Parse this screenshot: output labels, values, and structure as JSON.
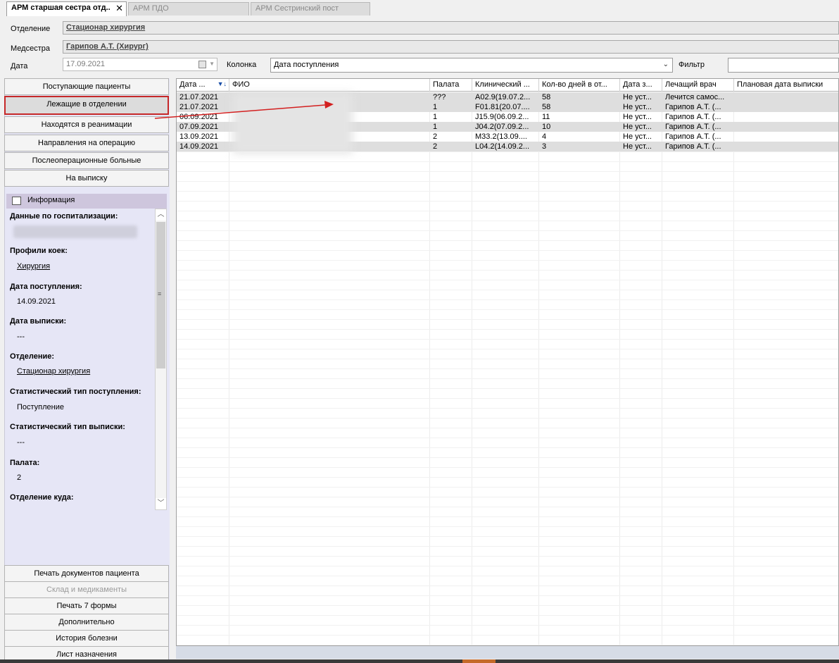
{
  "tabs": [
    {
      "label": "АРМ старшая сестра отд..",
      "active": true
    },
    {
      "label": "АРМ ПДО",
      "active": false
    },
    {
      "label": "АРМ Сестринский пост",
      "active": false
    }
  ],
  "header": {
    "department_label": "Отделение",
    "department_value": "Стационар хирургия",
    "nurse_label": "Медсестра",
    "nurse_value": "Гарипов А.Т. (Хирург)",
    "date_label": "Дата",
    "date_value": "17.09.2021",
    "column_label": "Колонка",
    "column_value": "Дата поступления",
    "filter_label": "Фильтр",
    "filter_value": ""
  },
  "nav": {
    "items": [
      {
        "label": "Поступающие пациенты",
        "selected": false
      },
      {
        "label": "Лежащие в отделении",
        "selected": true
      },
      {
        "label": "Находятся в реанимации",
        "selected": false
      },
      {
        "label": "Направления на операцию",
        "selected": false
      },
      {
        "label": "Послеоперационные больные",
        "selected": false
      },
      {
        "label": "На выписку",
        "selected": false
      }
    ],
    "bottom": [
      {
        "label": "Печать документов пациента",
        "disabled": false
      },
      {
        "label": "Склад и медикаменты",
        "disabled": true
      },
      {
        "label": "Печать 7 формы",
        "disabled": false
      },
      {
        "label": "Дополнительно",
        "disabled": false
      },
      {
        "label": "История болезни",
        "disabled": false
      },
      {
        "label": "Лист назначения",
        "disabled": false
      }
    ]
  },
  "info": {
    "title": "Информация",
    "hosp_label": "Данные по госпитализации:",
    "profile_label": "Профили коек:",
    "profile_value": "Хирургия",
    "admission_label": "Дата поступления:",
    "admission_value": "14.09.2021",
    "discharge_label": "Дата выписки:",
    "discharge_value": "---",
    "dept_label": "Отделение:",
    "dept_value": "Стационар хирургия",
    "stat_in_label": "Статистический тип поступления:",
    "stat_in_value": "Поступление",
    "stat_out_label": "Статистический тип выписки:",
    "stat_out_value": "---",
    "ward_label": "Палата:",
    "ward_value": "2",
    "dest_label": "Отделение куда:"
  },
  "grid": {
    "columns": [
      "Дата ...",
      "ФИО",
      "Палата",
      "Клинический ...",
      "Кол-во дней в от...",
      "Дата з...",
      "Лечащий врач",
      "Плановая дата выписки"
    ],
    "rows": [
      [
        "21.07.2021",
        "",
        "???",
        "A02.9(19.07.2...",
        "58",
        "Не уст...",
        "Лечится самос...",
        ""
      ],
      [
        "21.07.2021",
        "",
        "1",
        "F01.81(20.07....",
        "58",
        "Не уст...",
        "Гарипов А.Т. (...",
        ""
      ],
      [
        "06.09.2021",
        "",
        "1",
        "J15.9(06.09.2...",
        "11",
        "Не уст...",
        "Гарипов А.Т. (...",
        ""
      ],
      [
        "07.09.2021",
        "",
        "1",
        "J04.2(07.09.2...",
        "10",
        "Не уст...",
        "Гарипов А.Т. (...",
        ""
      ],
      [
        "13.09.2021",
        "",
        "2",
        "M33.2(13.09....",
        "4",
        "Не уст...",
        "Гарипов А.Т. (...",
        ""
      ],
      [
        "14.09.2021",
        "",
        "2",
        "L04.2(14.09.2...",
        "3",
        "Не уст...",
        "Гарипов А.Т. (...",
        ""
      ]
    ]
  }
}
